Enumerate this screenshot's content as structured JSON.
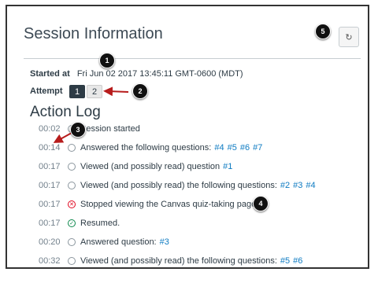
{
  "header": {
    "title": "Session Information",
    "refresh_icon": "refresh-icon"
  },
  "meta": {
    "started_label": "Started at",
    "started_value": "Fri Jun 02 2017 13:45:11 GMT-0600 (MDT)",
    "attempt_label": "Attempt",
    "attempts": [
      "1",
      "2"
    ]
  },
  "action_log": {
    "title": "Action Log",
    "entries": [
      {
        "time": "00:02",
        "icon": "circle",
        "text": "Session started",
        "links": []
      },
      {
        "time": "00:14",
        "icon": "circle",
        "text": "Answered the following questions:",
        "links": [
          "#4",
          "#5",
          "#6",
          "#7"
        ]
      },
      {
        "time": "00:17",
        "icon": "circle",
        "text": "Viewed (and possibly read) question",
        "links": [
          "#1"
        ]
      },
      {
        "time": "00:17",
        "icon": "circle",
        "text": "Viewed (and possibly read) the following questions:",
        "links": [
          "#2",
          "#3",
          "#4"
        ]
      },
      {
        "time": "00:17",
        "icon": "x-circle",
        "text": "Stopped viewing the Canvas quiz-taking page...",
        "links": []
      },
      {
        "time": "00:17",
        "icon": "check-circle",
        "text": "Resumed.",
        "links": []
      },
      {
        "time": "00:20",
        "icon": "circle",
        "text": "Answered question:",
        "links": [
          "#3"
        ]
      },
      {
        "time": "00:32",
        "icon": "circle",
        "text": "Viewed (and possibly read) the following questions:",
        "links": [
          "#5",
          "#6"
        ]
      }
    ]
  },
  "callouts": [
    "1",
    "2",
    "3",
    "4",
    "5"
  ],
  "colors": {
    "accent": "#0e7bc2",
    "dark": "#2d3b45",
    "error": "#e0061f",
    "success": "#0b874b",
    "arrow": "#b71c1c"
  }
}
